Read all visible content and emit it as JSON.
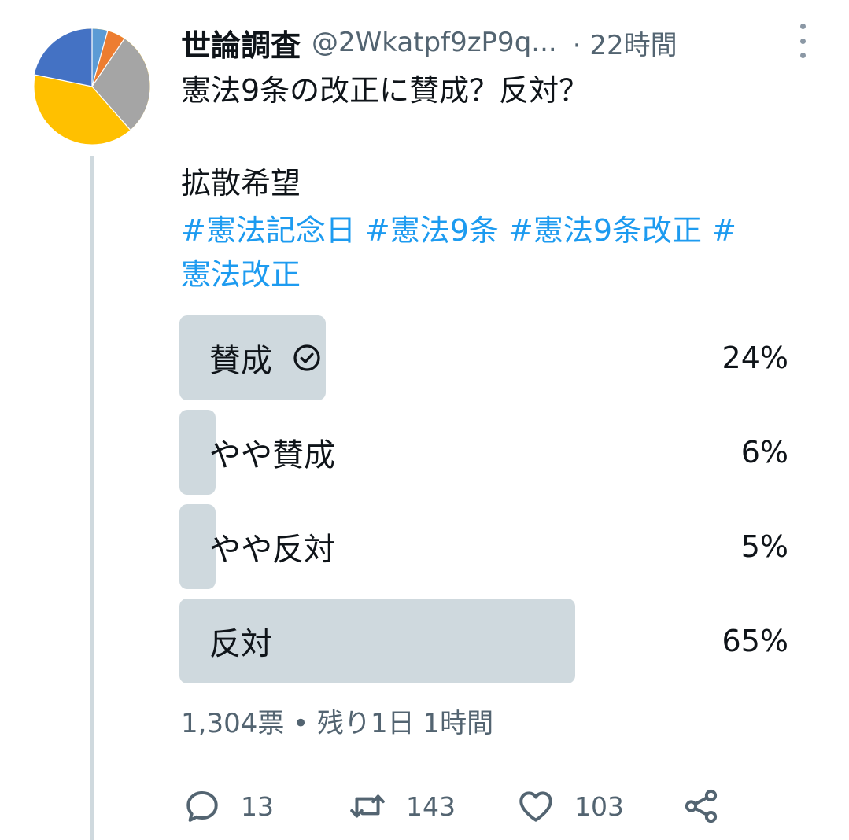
{
  "header": {
    "name": "世論調査",
    "handle": "@2Wkatpf9zP9q...",
    "time": "· 22時間"
  },
  "tweet": {
    "line1": "憲法9条の改正に賛成？反対？",
    "line2": "拡散希望",
    "hashtags_line1": "#憲法記念日 #憲法9条 #憲法9条改正 #",
    "hashtags_line2": "憲法改正"
  },
  "poll": {
    "options": [
      {
        "label": "賛成",
        "percent_text": "24%",
        "percent": 24,
        "selected": true
      },
      {
        "label": "やや賛成",
        "percent_text": "6%",
        "percent": 6,
        "selected": false
      },
      {
        "label": "やや反対",
        "percent_text": "5%",
        "percent": 5,
        "selected": false
      },
      {
        "label": "反対",
        "percent_text": "65%",
        "percent": 65,
        "selected": false
      }
    ],
    "meta": "1,304票 • 残り1日 1時間"
  },
  "actions": {
    "reply_count": "13",
    "retweet_count": "143",
    "like_count": "103"
  },
  "icons": {
    "reply": "reply-icon",
    "retweet": "retweet-icon",
    "like": "heart-icon",
    "share": "share-icon",
    "more": "more-icon",
    "selected": "check-circle-icon"
  },
  "colors": {
    "hashtag": "#1d9bf0",
    "poll_bar": "#cfd9de",
    "secondary_text": "#536471",
    "avatar_slices": [
      "#5b9bd5",
      "#ed7d31",
      "#a5a5a5",
      "#ffc000",
      "#4472c4"
    ]
  }
}
